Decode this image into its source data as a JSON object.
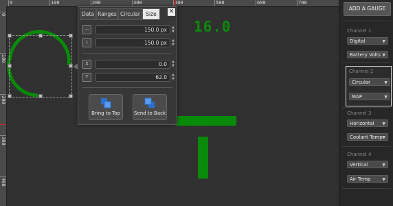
{
  "rulers": {
    "top_labels": [
      "0",
      "100",
      "200",
      "300",
      "400",
      "500",
      "600",
      "700"
    ],
    "left_labels": [
      "0",
      "100",
      "200",
      "300",
      "400"
    ]
  },
  "canvas": {
    "digital_readout": "16.0",
    "gauge_color": "#0a8a0a"
  },
  "panel": {
    "tabs": [
      {
        "label": "Data"
      },
      {
        "label": "Ranges"
      },
      {
        "label": "Circular"
      },
      {
        "label": "Size",
        "active": true
      }
    ],
    "close_label": "✕",
    "fields": {
      "width": {
        "icon": "—",
        "value": "150.0 px"
      },
      "height": {
        "icon": "I",
        "value": "150.0 px"
      },
      "x": {
        "icon": "X",
        "value": "0.0"
      },
      "y": {
        "icon": "Y",
        "value": "62.0"
      }
    },
    "buttons": {
      "bring_to_top": "Bring to Top",
      "send_to_back": "Send to Back"
    }
  },
  "sidebar": {
    "add_gauge_label": "ADD A GAUGE",
    "channels": [
      {
        "title": "Channel 1",
        "type": "Digital",
        "source": "Battery Volts"
      },
      {
        "title": "Channel 2",
        "type": "Circular",
        "source": "MAP",
        "selected": true
      },
      {
        "title": "Channel 3",
        "type": "Horizontal",
        "source": "Coolant Temp"
      },
      {
        "title": "Channel 4",
        "type": "Vertical",
        "source": "Air Temp"
      }
    ]
  },
  "colors": {
    "accent_green": "#0a8a0a",
    "panel_bg": "#373737",
    "sidebar_bg": "#272727"
  }
}
